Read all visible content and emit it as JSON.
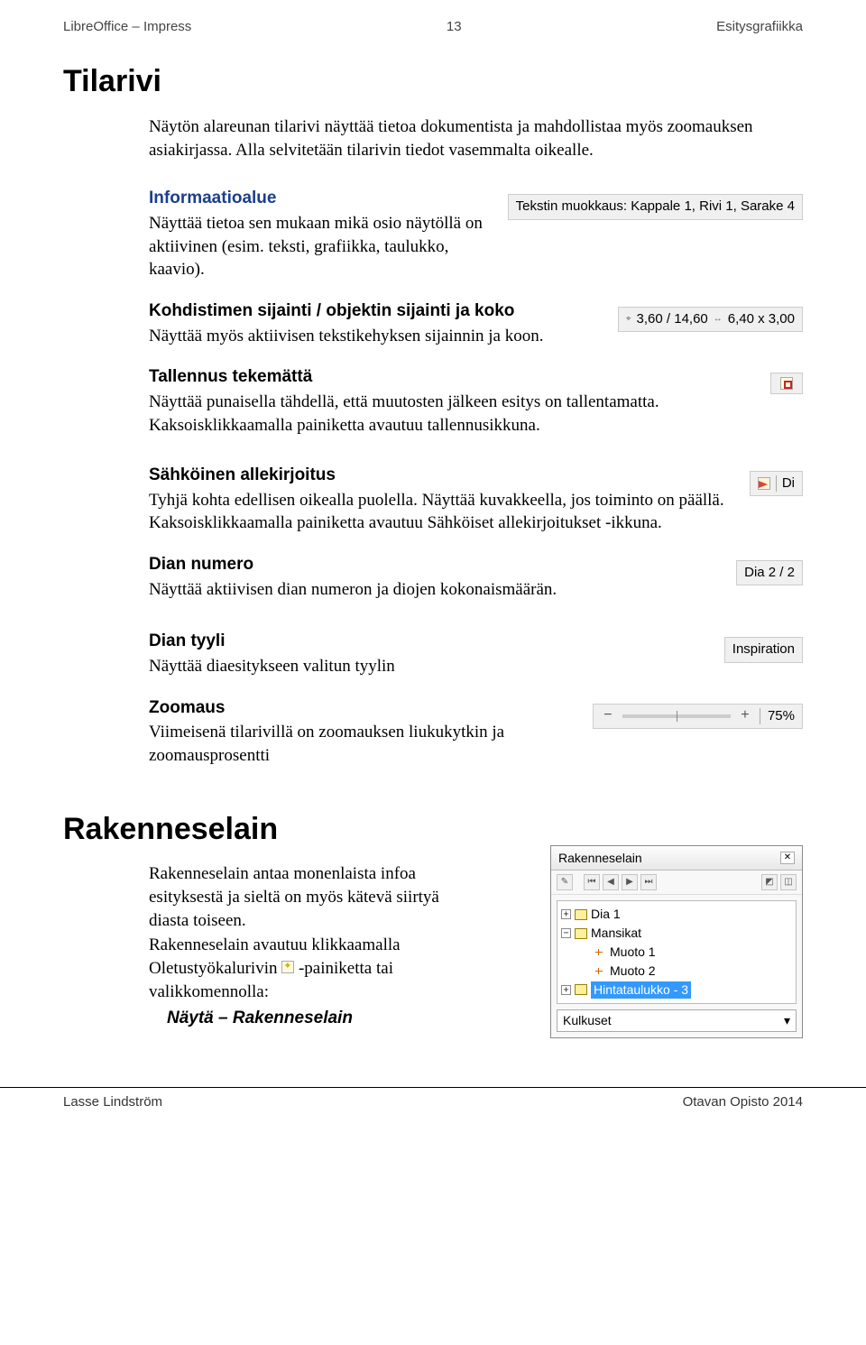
{
  "header": {
    "left": "LibreOffice – Impress",
    "center": "13",
    "right": "Esitysgrafiikka"
  },
  "section1": {
    "title": "Tilarivi",
    "intro": "Näytön alareunan tilarivi näyttää tietoa dokumentista ja mahdollistaa myös zoomauksen asiakirjassa. Alla selvitetään tilarivin tiedot vasemmalta oikealle.",
    "info_heading": "Informaatioalue",
    "info_body": "Näyttää tietoa sen mukaan mikä osio näytöllä on aktiivinen (esim. teksti, grafiikka, taulukko, kaavio).",
    "info_status": "Tekstin muokkaus: Kappale 1, Rivi 1, Sarake 4",
    "pos_heading": "Kohdistimen sijainti / objektin sijainti ja koko",
    "pos_body": "Näyttää myös aktiivisen tekstikehyksen sijainnin ja koon.",
    "pos_status_left": "3,60 / 14,60",
    "pos_status_right": "6,40 x 3,00",
    "save_heading": "Tallennus tekemättä",
    "save_body": "Näyttää punaisella tähdellä, että muutosten jälkeen esitys on tallentamatta. Kaksoisklikkaamalla painiketta avautuu tallennusikkuna.",
    "sig_heading": "Sähköinen allekirjoitus",
    "sig_body": "Tyhjä kohta edellisen oikealla puolella. Näyttää kuvakkeella, jos toiminto on päällä. Kaksoisklikkaamalla painiketta avautuu Sähköiset allekirjoitukset -ikkuna.",
    "sig_label": "Di",
    "slide_heading": "Dian numero",
    "slide_body": "Näyttää aktiivisen dian numeron ja diojen kokonaismäärän.",
    "slide_status": "Dia 2 / 2",
    "style_heading": "Dian tyyli",
    "style_body": "Näyttää diaesitykseen valitun tyylin",
    "style_status": "Inspiration",
    "zoom_heading": "Zoomaus",
    "zoom_body": "Viimeisenä tilarivillä on zoomauksen liukukytkin ja zoomausprosentti",
    "zoom_value": "75%"
  },
  "section2": {
    "title": "Rakenneselain",
    "body1": "Rakenneselain antaa monenlaista infoa esityksestä ja sieltä on myös kätevä siirtyä diasta toiseen.",
    "body2a": "Rakenneselain avautuu klikkaamalla Oletustyökalurivin ",
    "body2b": " -painiketta tai valikkomennolla:",
    "menu": "Näytä – Rakenneselain",
    "nav_title": "Rakenneselain",
    "tree": {
      "dia1": "Dia 1",
      "mansikat": "Mansikat",
      "muoto1": "Muoto 1",
      "muoto2": "Muoto 2",
      "hinta": "Hintataulukko - 3"
    },
    "combo": "Kulkuset"
  },
  "footer": {
    "left": "Lasse Lindström",
    "right": "Otavan Opisto 2014"
  }
}
